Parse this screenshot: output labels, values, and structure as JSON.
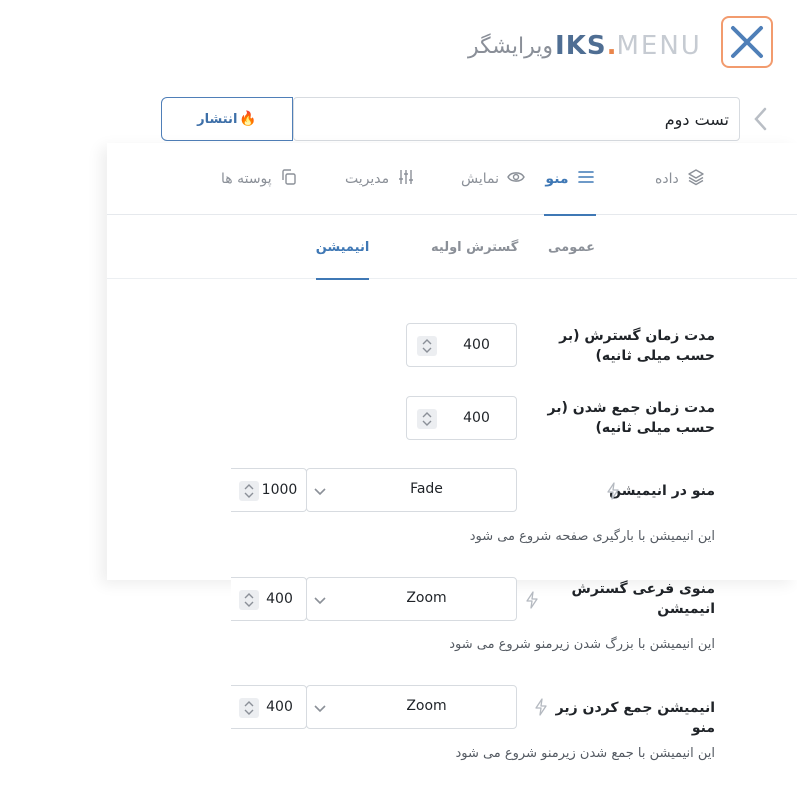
{
  "header": {
    "brand_prefix": "ویرایشگر",
    "brand_iks": "IKS",
    "brand_dot": ".",
    "brand_menu": "MENU"
  },
  "title_input": {
    "value": "تست دوم"
  },
  "publish_button": {
    "label": "انتشار",
    "icon": "🔥"
  },
  "main_tabs": [
    {
      "label": "داده",
      "icon": "layers-icon"
    },
    {
      "label": "منو",
      "icon": "menu-lines-icon",
      "active": true
    },
    {
      "label": "نمایش",
      "icon": "eye-icon"
    },
    {
      "label": "مدیریت",
      "icon": "sliders-icon"
    },
    {
      "label": "پوسته ها",
      "icon": "copy-icon"
    }
  ],
  "sub_tabs": [
    {
      "label": "عمومی"
    },
    {
      "label": "گسترش اولیه"
    },
    {
      "label": "انیمیشن",
      "active": true
    }
  ],
  "fields": {
    "expand_duration": {
      "label": "مدت زمان گسترش (بر حسب میلی ثانیه)",
      "value": "400"
    },
    "collapse_duration": {
      "label": "مدت زمان جمع شدن (بر حسب میلی ثانیه)",
      "value": "400"
    },
    "menu_animation": {
      "label": "منو در انیمیشن",
      "select": "Fade",
      "duration": "1000",
      "help": "این انیمیشن با بارگیری صفحه شروع می شود"
    },
    "submenu_expand_animation": {
      "label": "منوی فرعی گسترش انیمیشن",
      "select": "Zoom",
      "duration": "400",
      "help": "این انیمیشن با بزرگ شدن زیرمنو شروع می شود"
    },
    "submenu_collapse_animation": {
      "label": "انیمیشن جمع کردن زیر منو",
      "select": "Zoom",
      "duration": "400",
      "help": "این انیمیشن با جمع شدن زیرمنو شروع می شود"
    }
  },
  "colors": {
    "accent": "#3f78b5",
    "logo_border": "#f29b6e"
  }
}
